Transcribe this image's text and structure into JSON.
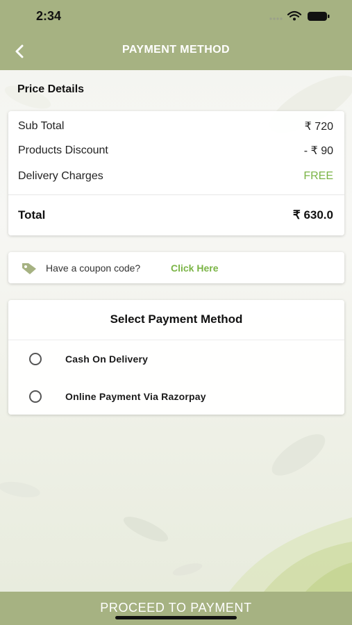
{
  "status_bar": {
    "time": "2:34"
  },
  "header": {
    "title": "PAYMENT METHOD",
    "back_icon": "chevron-left-icon"
  },
  "price_details": {
    "section_title": "Price Details",
    "rows": [
      {
        "label": "Sub Total",
        "value": "₹ 720"
      },
      {
        "label": "Products Discount",
        "value": "- ₹ 90"
      },
      {
        "label": "Delivery Charges",
        "value": "FREE"
      }
    ],
    "total": {
      "label": "Total",
      "value": "₹ 630.0"
    }
  },
  "coupon": {
    "text": "Have a coupon code?",
    "link": "Click Here",
    "icon": "tag-icon"
  },
  "payment": {
    "title": "Select Payment Method",
    "options": [
      {
        "label": "Cash On Delivery"
      },
      {
        "label": "Online Payment Via Razorpay"
      }
    ]
  },
  "footer": {
    "button": "PROCEED TO PAYMENT"
  },
  "colors": {
    "brand": "#a6b282",
    "accent_green": "#7ab445"
  }
}
